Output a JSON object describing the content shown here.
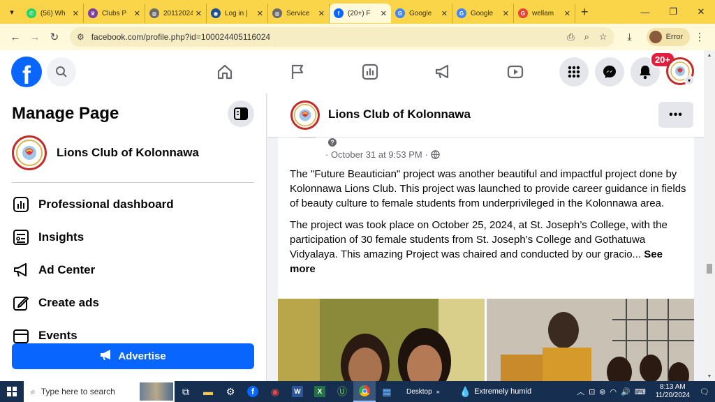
{
  "browser": {
    "tabs": [
      {
        "label": "(56) Wh",
        "fav_color": "#25d366",
        "fav_glyph": "✆"
      },
      {
        "label": "Clubs P",
        "fav_color": "#7b3fa0",
        "fav_glyph": "♛"
      },
      {
        "label": "20112024",
        "fav_color": "#6b6b6b",
        "fav_glyph": "◍"
      },
      {
        "label": "Log in |",
        "fav_color": "#1d4f91",
        "fav_glyph": "◉"
      },
      {
        "label": "Service",
        "fav_color": "#6b6b6b",
        "fav_glyph": "◍"
      },
      {
        "label": "(20+) F",
        "fav_color": "#0866ff",
        "fav_glyph": "f"
      },
      {
        "label": "Google",
        "fav_color": "#4285f4",
        "fav_glyph": "G"
      },
      {
        "label": "Google",
        "fav_color": "#4285f4",
        "fav_glyph": "G"
      },
      {
        "label": "wellam",
        "fav_color": "#ea4335",
        "fav_glyph": "G"
      }
    ],
    "active_tab": 5,
    "new_tab_glyph": "+",
    "url": "facebook.com/profile.php?id=100024405116024",
    "profile_label": "Error"
  },
  "fb_nav": {
    "logo": "f",
    "notification_badge": "20+"
  },
  "sidebar": {
    "title": "Manage Page",
    "page_name": "Lions Club of Kolonnawa",
    "items": [
      {
        "label": "Professional dashboard",
        "icon": "dashboard-icon"
      },
      {
        "label": "Insights",
        "icon": "insights-icon"
      },
      {
        "label": "Ad Center",
        "icon": "megaphone-icon"
      },
      {
        "label": "Create ads",
        "icon": "pencil-icon"
      },
      {
        "label": "Events",
        "icon": "calendar-icon"
      }
    ],
    "advertise_label": "Advertise"
  },
  "page_header": {
    "name": "Lions Club of Kolonnawa",
    "more_glyph": "•••"
  },
  "post": {
    "meta_time": "· October 31 at 9:53 PM ·",
    "paragraph1": "The \"Future Beautician\" project was another beautiful and impactful project done by Kolonnawa Lions Club. This project was launched to provide career guidance in fields of beauty culture to female students from underprivileged in the Kolonnawa area.",
    "paragraph2": "The project was took place on October 25, 2024, at St. Joseph’s College, with the participation of 30 female students from St. Joseph’s College and Gothatuwa Vidyalaya. This amazing Project was chaired and conducted by our gracio...",
    "see_more": "See more"
  },
  "taskbar": {
    "search_placeholder": "Type here to search",
    "desktop_label": "Desktop",
    "weather": "Extremely humid",
    "time": "8:13 AM",
    "date": "11/20/2024"
  },
  "colors": {
    "tabbar": "#fad54a",
    "fb_blue": "#0866ff",
    "badge_red": "#e41e3f",
    "taskbar": "#162f50"
  }
}
